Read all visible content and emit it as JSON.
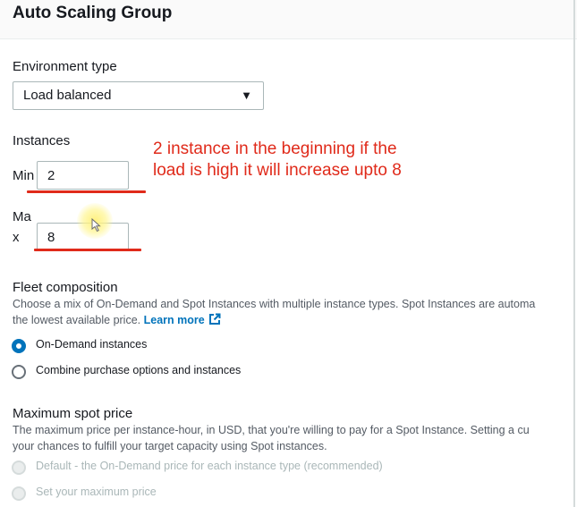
{
  "header": {
    "title": "Auto Scaling Group"
  },
  "environment": {
    "label": "Environment type",
    "selected": "Load balanced",
    "caret_icon": "caret-down-icon"
  },
  "instances": {
    "label": "Instances",
    "min_label": "Min",
    "min_value": "2",
    "max_label_line1": "Ma",
    "max_label_line2": "x",
    "max_value": "8"
  },
  "annotation": {
    "line1": "2 instance in the beginning if the",
    "line2": "load is high it will increase upto 8",
    "color": "#e02a1a"
  },
  "fleet": {
    "title": "Fleet composition",
    "desc_line1": "Choose a mix of On-Demand and Spot Instances with multiple instance types. Spot Instances are automa",
    "desc_line2": "the lowest available price.",
    "learn_more": "Learn more",
    "options": [
      {
        "label": "On-Demand instances",
        "checked": true
      },
      {
        "label": "Combine purchase options and instances",
        "checked": false
      }
    ]
  },
  "spot": {
    "title": "Maximum spot price",
    "desc_line1": "The maximum price per instance-hour, in USD, that you're willing to pay for a Spot Instance. Setting a cu",
    "desc_line2": "your chances to fulfill your target capacity using Spot instances.",
    "options": [
      {
        "label": "Default - the On-Demand price for each instance type (recommended)",
        "disabled": true
      },
      {
        "label": "Set your maximum price",
        "disabled": true
      }
    ]
  },
  "colors": {
    "accent": "#0073bb",
    "annotation": "#e02a1a",
    "text": "#16191f",
    "muted": "#545b64"
  }
}
